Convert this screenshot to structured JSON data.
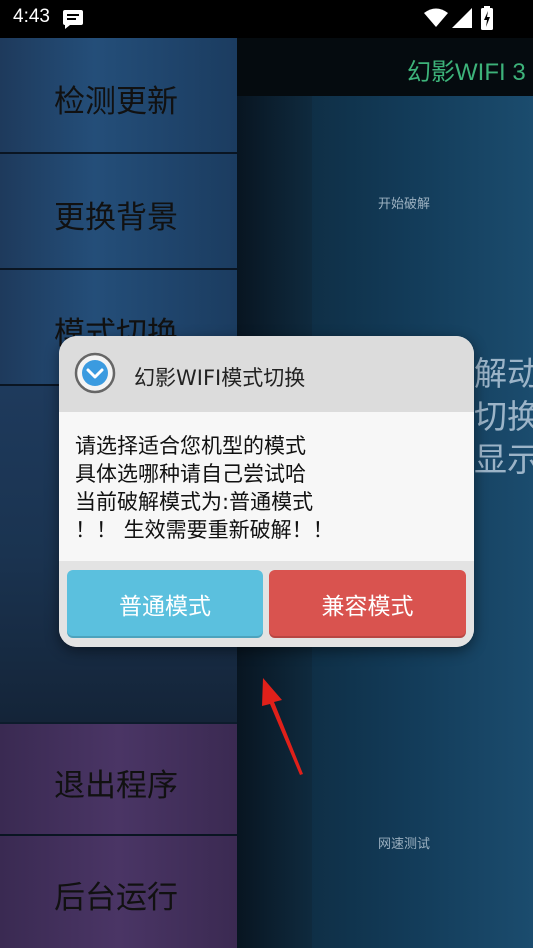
{
  "status_bar": {
    "time": "4:43",
    "icons": [
      "message-icon",
      "wifi-icon",
      "signal-icon",
      "battery-charging-icon"
    ]
  },
  "app": {
    "title": "幻影WIFI 3",
    "start_crack_label": "开始破解",
    "speed_test_label": "网速测试",
    "side_text": [
      "解动",
      "切换",
      "显示"
    ]
  },
  "drawer": {
    "items": [
      {
        "label": "检测更新"
      },
      {
        "label": "更换背景"
      },
      {
        "label": "模式切换"
      },
      {
        "label": "退出程序"
      },
      {
        "label": "后台运行"
      }
    ]
  },
  "dialog": {
    "icon": "chevron-down-circle-icon",
    "title": "幻影WIFI模式切换",
    "lines": [
      "请选择适合您机型的模式",
      "具体选哪种请自己尝试哈",
      "当前破解模式为:普通模式",
      "！！ 生效需要重新破解！！"
    ],
    "buttons": {
      "normal": "普通模式",
      "compat": "兼容模式"
    }
  },
  "colors": {
    "normal_button": "#5bc0de",
    "compat_button": "#d9534f",
    "app_title": "#3db37a",
    "annotation_arrow": "#e0201a"
  }
}
